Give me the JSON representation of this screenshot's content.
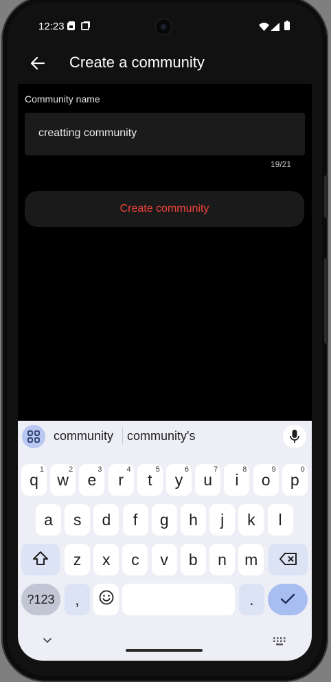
{
  "status_bar": {
    "time": "12:23",
    "icons": [
      "sim-card-icon",
      "screen-icon",
      "wifi-icon",
      "signal-icon",
      "battery-icon"
    ]
  },
  "app_bar": {
    "back_icon": "arrow-left-icon",
    "title": "Create a community"
  },
  "form": {
    "field_label": "Community name",
    "field_value": "creatting community",
    "counter": "19/21",
    "submit_label": "Create community"
  },
  "keyboard": {
    "suggestions": [
      "community",
      "community's"
    ],
    "row1": [
      {
        "k": "q",
        "h": "1"
      },
      {
        "k": "w",
        "h": "2"
      },
      {
        "k": "e",
        "h": "3"
      },
      {
        "k": "r",
        "h": "4"
      },
      {
        "k": "t",
        "h": "5"
      },
      {
        "k": "y",
        "h": "6"
      },
      {
        "k": "u",
        "h": "7"
      },
      {
        "k": "i",
        "h": "8"
      },
      {
        "k": "o",
        "h": "9"
      },
      {
        "k": "p",
        "h": "0"
      }
    ],
    "row2": [
      "a",
      "s",
      "d",
      "f",
      "g",
      "h",
      "j",
      "k",
      "l"
    ],
    "row3": [
      "z",
      "x",
      "c",
      "v",
      "b",
      "n",
      "m"
    ],
    "symbols_label": "?123",
    "comma": ",",
    "period": "."
  },
  "colors": {
    "accent": "#f1433a",
    "background": "#000000",
    "appbar": "#111111",
    "field": "#1b1b1b",
    "keyboard": "#eeeff6"
  }
}
